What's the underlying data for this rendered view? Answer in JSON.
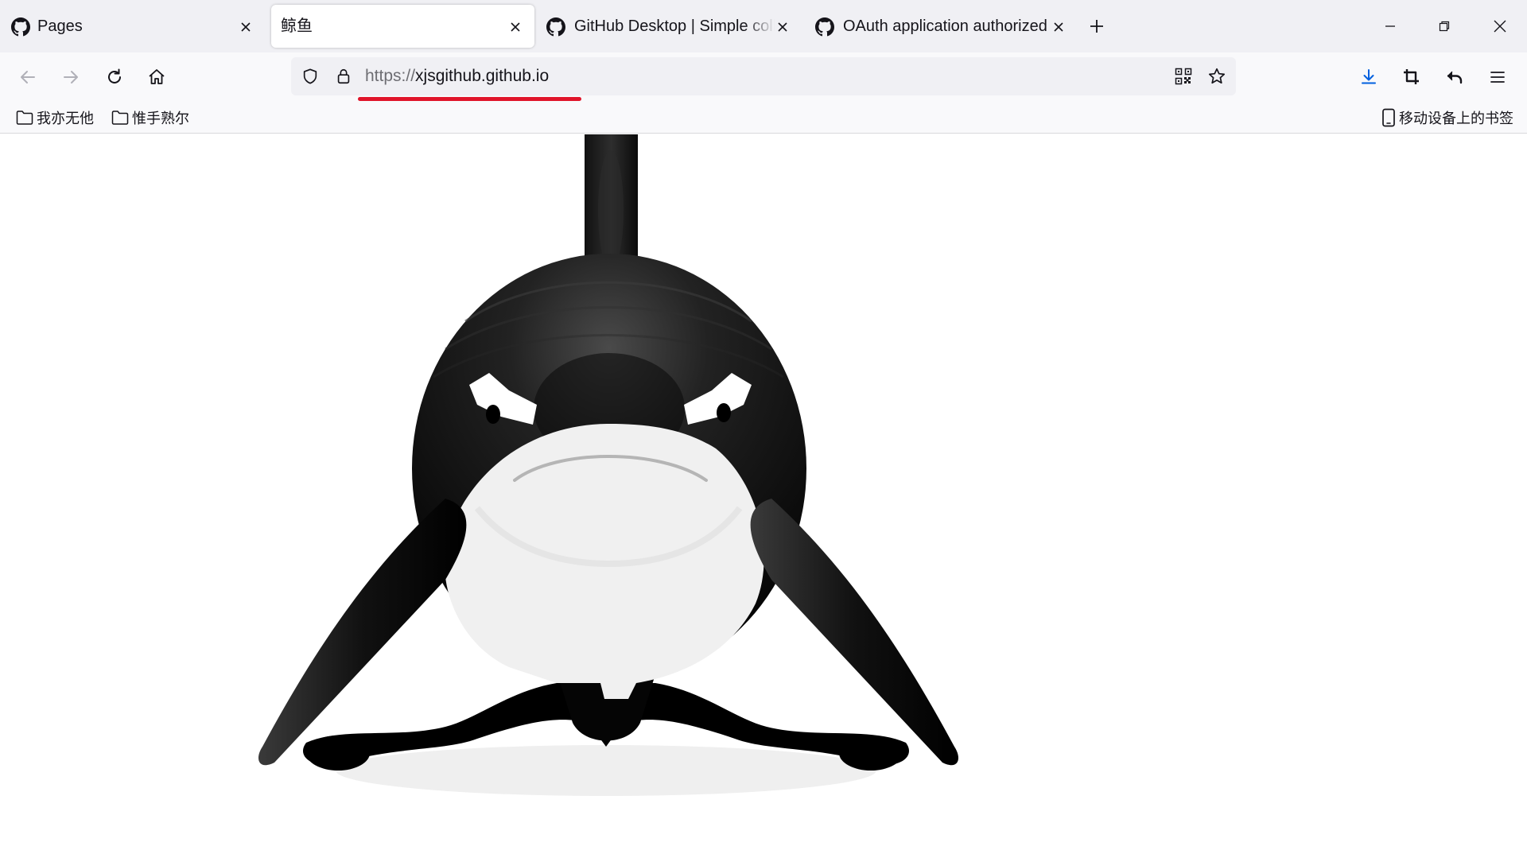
{
  "tabs": [
    {
      "title": "Pages",
      "icon": "github-icon",
      "selected": false
    },
    {
      "title": "鲸鱼",
      "icon": "none",
      "selected": true
    },
    {
      "title": "GitHub Desktop | Simple collaboration",
      "icon": "github-icon",
      "selected": false
    },
    {
      "title": "OAuth application authorized",
      "icon": "github-icon",
      "selected": false
    }
  ],
  "toolbar": {
    "back_icon": "arrow-left-icon",
    "forward_icon": "arrow-right-icon",
    "reload_icon": "reload-icon",
    "home_icon": "home-icon"
  },
  "urlbar": {
    "scheme": "https://",
    "host": "xjsgithub.github.io",
    "annotation_color": "#e0142a"
  },
  "bookmarks": [
    {
      "label": "我亦无他",
      "icon": "folder-icon"
    },
    {
      "label": "惟手熟尔",
      "icon": "folder-icon"
    }
  ],
  "mobile_bookmarks": {
    "label": "移动设备上的书签",
    "icon": "mobile-icon"
  },
  "page": {
    "illustration": "orca-whale-illustration"
  },
  "colors": {
    "tabstrip": "#f0f0f4",
    "toolbar": "#f9f9fb",
    "download_accent": "#0060df"
  }
}
